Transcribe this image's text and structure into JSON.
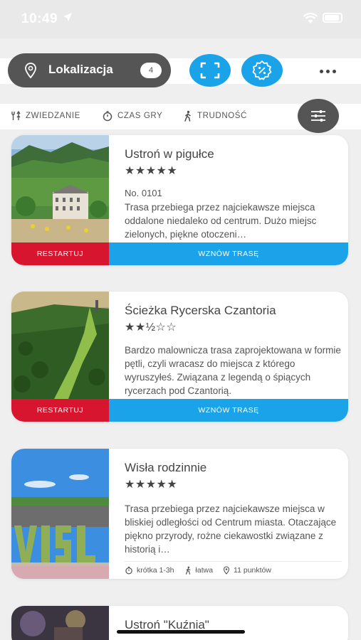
{
  "status": {
    "time": "10:49"
  },
  "header": {
    "location_label": "Lokalizacja",
    "location_count": "4",
    "colors": {
      "accent": "#1aa3e8",
      "dark_pill": "#555555",
      "restart": "#d8152f"
    }
  },
  "filters": [
    {
      "label": "ZWIEDZANIE",
      "icon": "sightseeing-icon"
    },
    {
      "label": "CZAS GRY",
      "icon": "timer-icon"
    },
    {
      "label": "TRUDNOŚĆ",
      "icon": "walking-icon"
    }
  ],
  "cards": [
    {
      "title": "Ustroń w pigułce",
      "stars": "★★★★★",
      "rating": 5,
      "code": "No. 0101",
      "desc": "Trasa przebiega przez najciekawsze miejsca oddalone niedaleko od centrum. Dużo miejsc zielonych, piękne otoczeni…",
      "restart_label": "RESTARTUJ",
      "resume_label": "WZNÓW TRASĘ"
    },
    {
      "title": "Ścieżka Rycerska  Czantoria",
      "stars": "★★½☆☆",
      "rating": 2.5,
      "desc": "Bardzo malownicza trasa zaprojektowana w formie pętli, czyli wracasz do miejsca z którego wyruszyłeś. Związana z legendą o śpiących rycerzach pod Czantorią.",
      "restart_label": "RESTARTUJ",
      "resume_label": "WZNÓW TRASĘ"
    },
    {
      "title": "Wisła rodzinnie",
      "stars": "★★★★★",
      "rating": 5,
      "desc": "Trasa przebiega przez najciekawsze miejsca w bliskiej odległości  od Centrum miasta. Otaczające piękno  przyrody, rożne ciekawostki związane z historią i…",
      "meta": {
        "duration": "krótka 1-3h",
        "difficulty": "łatwa",
        "points": "11 punktów"
      }
    },
    {
      "title": "Ustroń \"Kuźnia\""
    }
  ]
}
